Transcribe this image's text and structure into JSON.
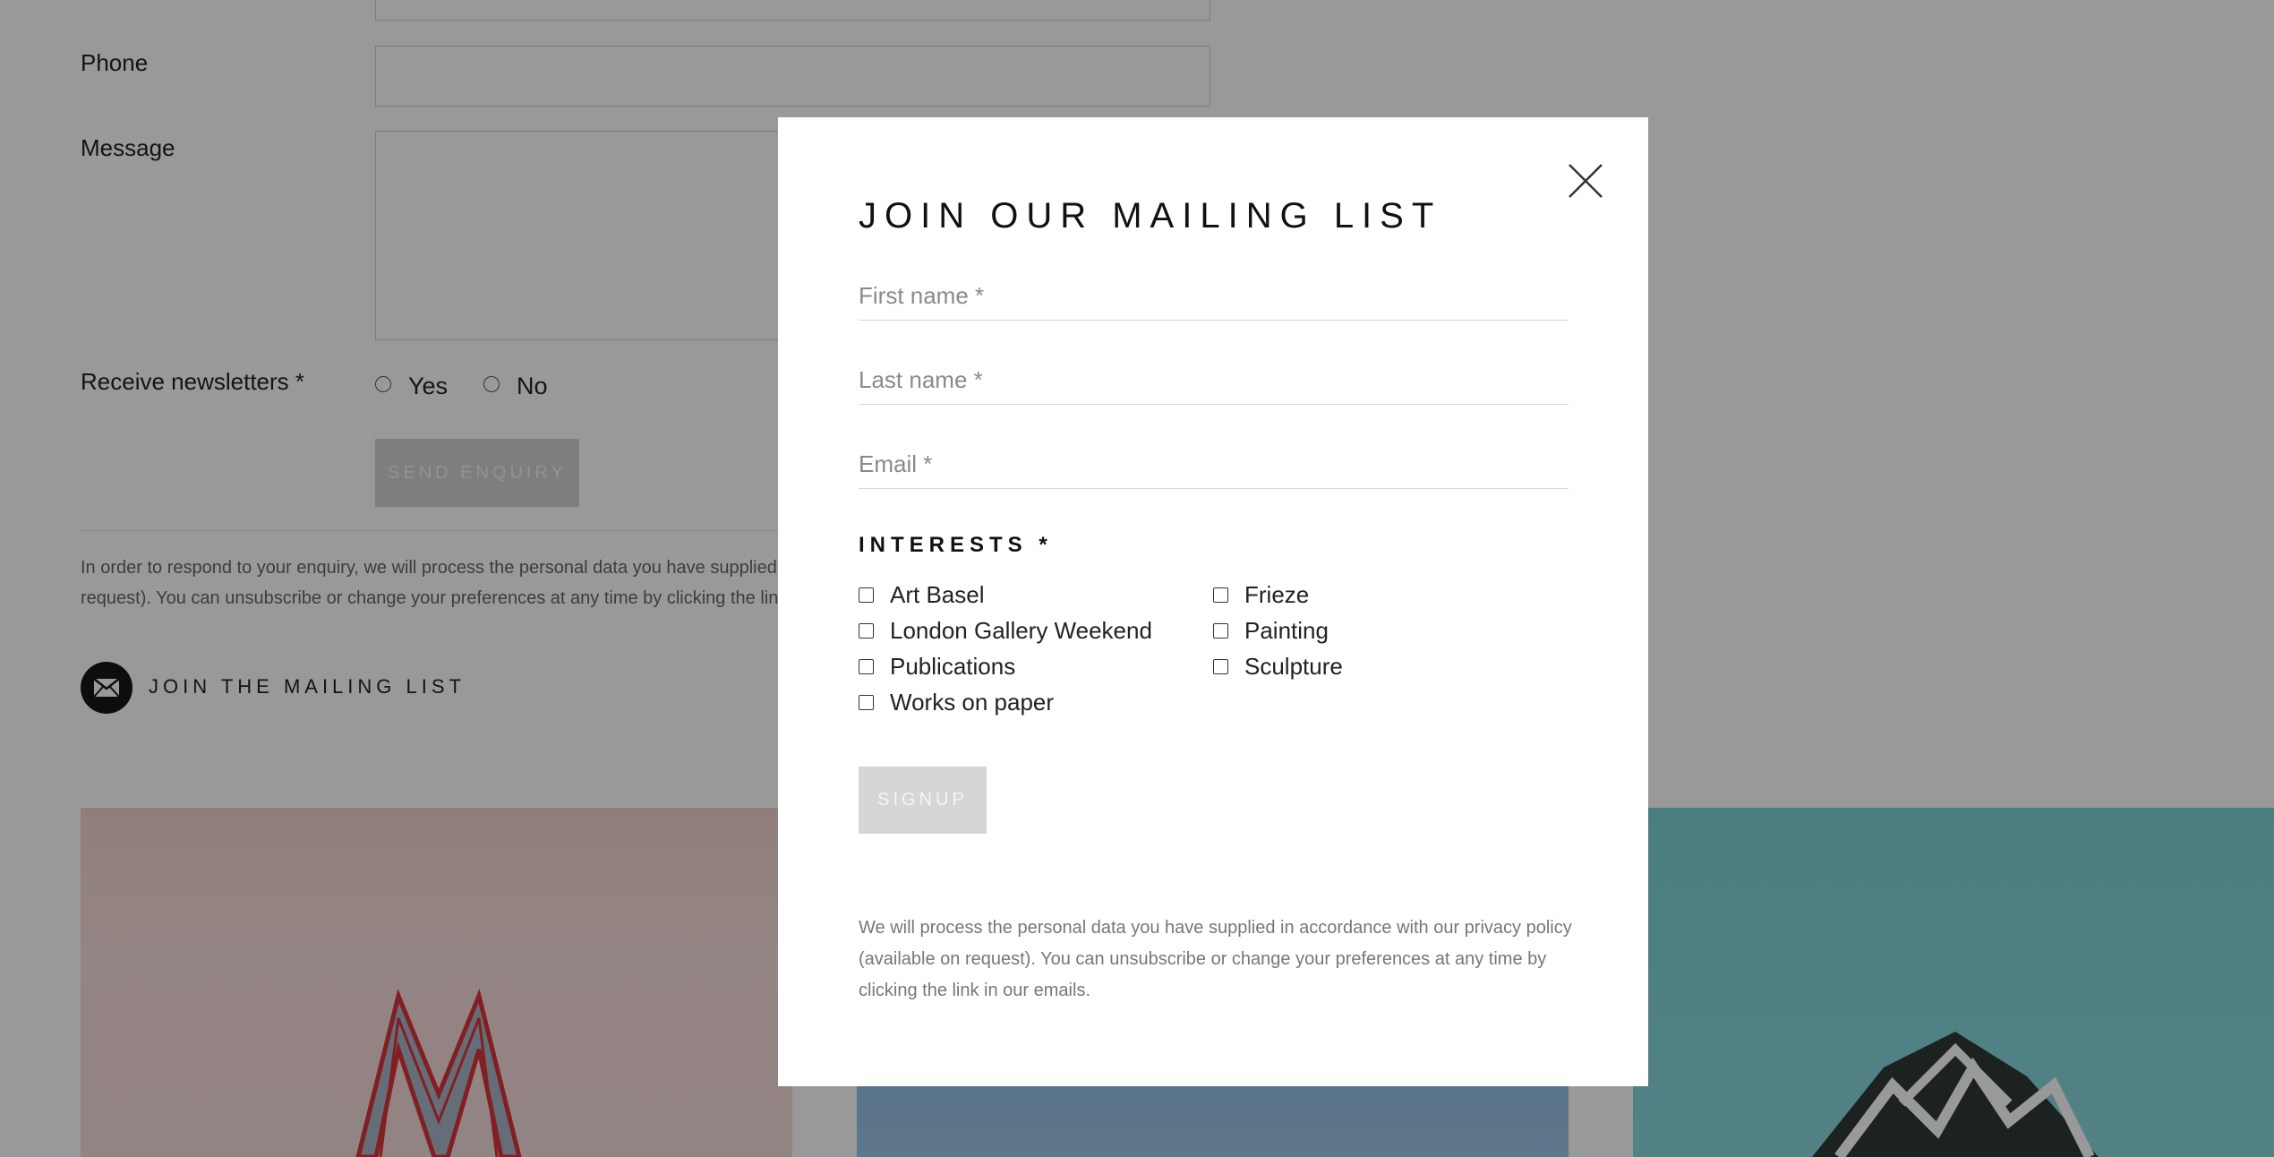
{
  "enquiry_form": {
    "email_value": "",
    "phone_label": "Phone",
    "message_label": "Message",
    "newsletter_label": "Receive newsletters *",
    "newsletter_options": [
      "Yes",
      "No"
    ],
    "send_button": "SEND ENQUIRY",
    "privacy_lines": [
      "In order to respond to your enquiry, we will process the personal data you have supplied in",
      "request). You can unsubscribe or change your preferences at any time by clicking the link"
    ]
  },
  "mailing_link": {
    "label": "JOIN THE MAILING LIST",
    "icon": "envelope-icon"
  },
  "modal": {
    "title": "JOIN OUR MAILING LIST",
    "close_icon": "close-icon",
    "first_name_placeholder": "First name *",
    "last_name_placeholder": "Last name *",
    "email_placeholder": "Email *",
    "interests_heading": "INTERESTS *",
    "interests": [
      "Art Basel",
      "Frieze",
      "London Gallery Weekend",
      "Painting",
      "Publications",
      "Sculpture",
      "Works on paper"
    ],
    "signup_button": "SIGNUP",
    "privacy_lines": [
      "We will process the personal data you have supplied in accordance with our privacy policy",
      "(available on request). You can unsubscribe or change your preferences at any time by",
      "clicking the link in our emails."
    ]
  }
}
